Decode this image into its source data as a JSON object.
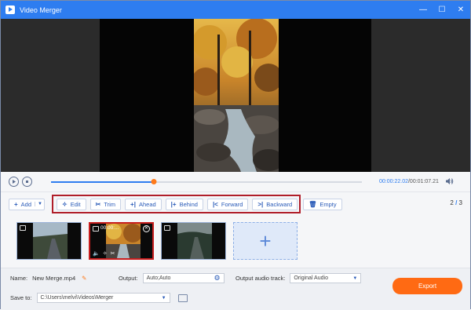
{
  "window": {
    "title": "Video Merger",
    "controls": [
      "—",
      "☐",
      "✕"
    ]
  },
  "player": {
    "current_time": "00:00:22.02",
    "total_time": "/00:01:07.21",
    "progress": 0.33
  },
  "toolbar": {
    "add_label": "Add",
    "buttons": [
      {
        "label": "Edit",
        "icon": "✧"
      },
      {
        "label": "Trim",
        "icon": "✂"
      },
      {
        "label": "Ahead",
        "icon": "+|"
      },
      {
        "label": "Behind",
        "icon": "|+"
      },
      {
        "label": "Forward",
        "icon": "|<"
      },
      {
        "label": "Backward",
        "icon": ">|"
      }
    ],
    "empty_label": "Empty",
    "page": "2",
    "page_total": "3"
  },
  "clips": [
    {
      "selected": false,
      "duration": ""
    },
    {
      "selected": true,
      "duration": "00:00:..."
    },
    {
      "selected": false,
      "duration": ""
    }
  ],
  "bottom": {
    "name_label": "Name:",
    "name_value": "New Merge.mp4",
    "output_label": "Output:",
    "output_value": "Auto;Auto",
    "audio_label": "Output audio track:",
    "audio_value": "Original Audio",
    "save_label": "Save to:",
    "save_path": "C:\\Users\\melvi\\Videos\\Merger",
    "export_label": "Export"
  },
  "colors": {
    "accent": "#2e7df0",
    "export": "#ff6a13",
    "highlight": "#b01e2a"
  }
}
